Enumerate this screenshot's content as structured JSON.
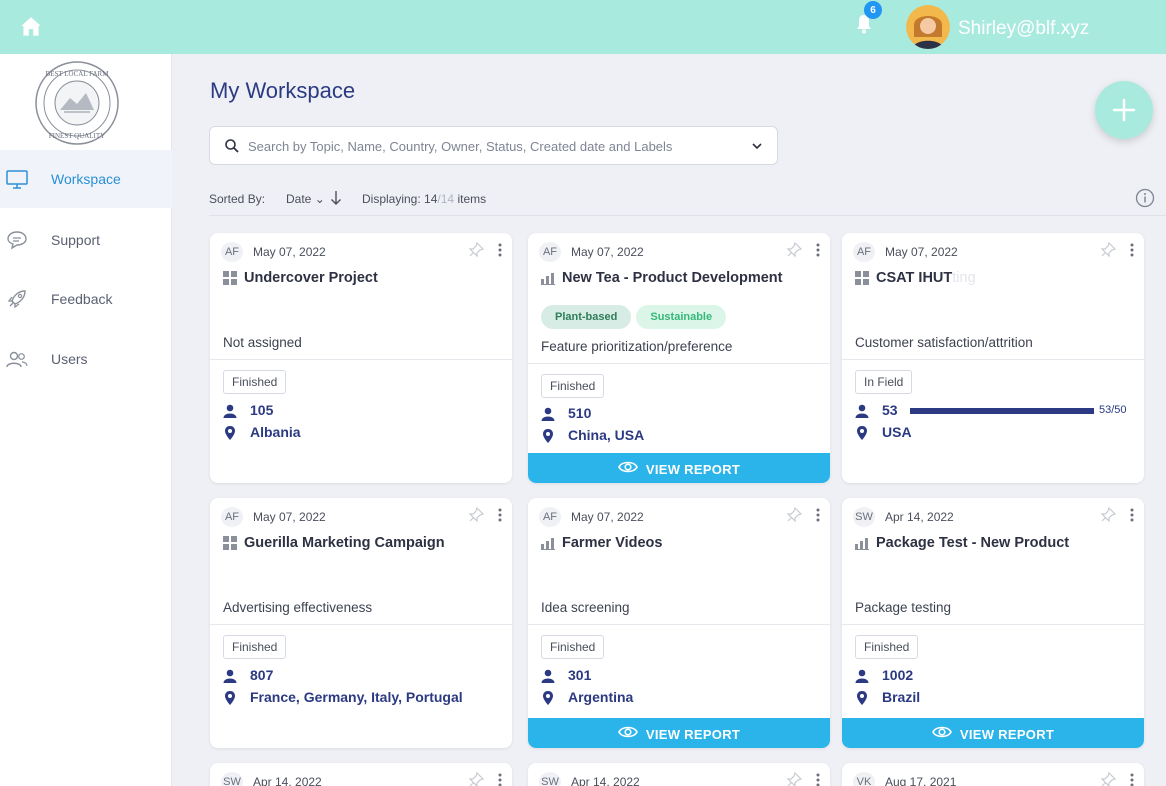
{
  "topbar": {
    "home_icon": "home-icon",
    "notifications": {
      "icon": "bell-icon",
      "count": "6"
    },
    "user": {
      "email": "Shirley@blf.xyz",
      "avatar": "avatar"
    },
    "bg_color": "#a9eadf"
  },
  "sidebar": {
    "logo_text": [
      "BEST LOCAL FARM",
      "FINEST QUALITY"
    ],
    "items": [
      {
        "label": "Workspace",
        "icon": "monitor-icon",
        "active": true
      },
      {
        "label": "Support",
        "icon": "chat-icon",
        "active": false
      },
      {
        "label": "Feedback",
        "icon": "rocket-icon",
        "active": false
      },
      {
        "label": "Users",
        "icon": "users-icon",
        "active": false
      }
    ]
  },
  "main": {
    "title": "My Workspace",
    "search": {
      "placeholder": "Search by Topic, Name, Country, Owner, Status, Created date and Labels"
    },
    "add_button_icon": "plus-icon",
    "sort": {
      "label": "Sorted By:",
      "value": "Date",
      "direction": "descending"
    },
    "display": {
      "prefix": "Displaying:",
      "shown": "14",
      "total": "/14",
      "suffix": "items"
    }
  },
  "cards": [
    {
      "owner": "AF",
      "date": "May 07, 2022",
      "type_icon": "grid-icon",
      "title": "Undercover Project",
      "ghost": "",
      "tags": [],
      "category": "Not assigned",
      "status": "Finished",
      "respondents": "105",
      "location": "Albania",
      "report": null,
      "progress": null
    },
    {
      "owner": "AF",
      "date": "May 07, 2022",
      "type_icon": "bar-chart-icon",
      "title": "New Tea - Product Development",
      "ghost": "",
      "tags": [
        "Plant-based",
        "Sustainable"
      ],
      "category": "Feature prioritization/preference",
      "status": "Finished",
      "respondents": "510",
      "location": "China, USA",
      "report": "VIEW REPORT",
      "progress": null
    },
    {
      "owner": "AF",
      "date": "May 07, 2022",
      "type_icon": "grid-icon",
      "title": "CSAT IHUT",
      "ghost": "ting",
      "tags": [],
      "category": "Customer satisfaction/attrition",
      "status": "In Field",
      "respondents": "53",
      "location": "USA",
      "report": null,
      "progress": {
        "label": "53/50",
        "value": 1.0
      }
    },
    {
      "owner": "AF",
      "date": "May 07, 2022",
      "type_icon": "grid-icon",
      "title": "Guerilla Marketing Campaign",
      "ghost": "",
      "tags": [],
      "category": "Advertising effectiveness",
      "status": "Finished",
      "respondents": "807",
      "location": "France, Germany, Italy, Portugal",
      "report": null,
      "progress": null
    },
    {
      "owner": "AF",
      "date": "May 07, 2022",
      "type_icon": "bar-chart-icon",
      "title": "Farmer Videos",
      "ghost": "",
      "tags": [],
      "category": "Idea screening",
      "status": "Finished",
      "respondents": "301",
      "location": "Argentina",
      "report": "VIEW REPORT",
      "progress": null
    },
    {
      "owner": "SW",
      "date": "Apr 14, 2022",
      "type_icon": "bar-chart-icon",
      "title": "Package Test - New Product",
      "ghost": "",
      "tags": [],
      "category": "Package testing",
      "status": "Finished",
      "respondents": "1002",
      "location": "Brazil",
      "report": "VIEW REPORT",
      "progress": null
    },
    {
      "owner": "SW",
      "date": "Apr 14, 2022"
    },
    {
      "owner": "SW",
      "date": "Apr 14, 2022"
    },
    {
      "owner": "VK",
      "date": "Aug 17, 2021"
    }
  ]
}
